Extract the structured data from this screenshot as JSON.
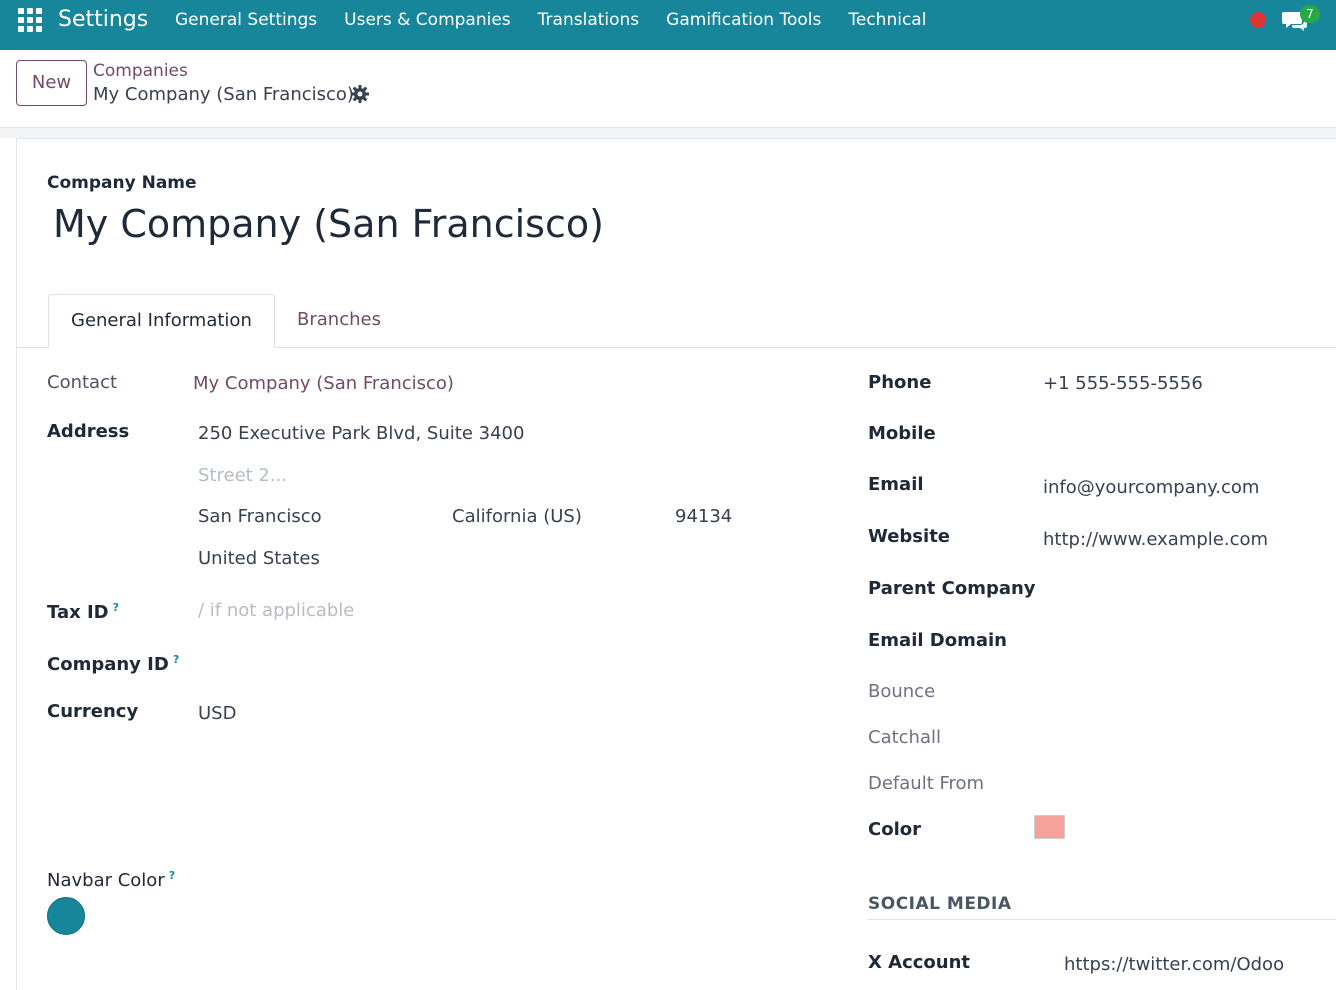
{
  "navbar": {
    "app_name": "Settings",
    "menu": [
      "General Settings",
      "Users & Companies",
      "Translations",
      "Gamification Tools",
      "Technical"
    ],
    "chat_count": "7",
    "color": "#17869a"
  },
  "control": {
    "new_label": "New",
    "breadcrumb_parent": "Companies",
    "breadcrumb_current": "My Company (San Francisco)"
  },
  "form": {
    "company_name_label": "Company Name",
    "company_name": "My Company (San Francisco)",
    "tabs": [
      "General Information",
      "Branches"
    ],
    "left": {
      "contact_label": "Contact",
      "contact_value": "My Company (San Francisco)",
      "address_label": "Address",
      "street": "250 Executive Park Blvd, Suite 3400",
      "street2_placeholder": "Street 2...",
      "city": "San Francisco",
      "state": "California (US)",
      "zip": "94134",
      "country": "United States",
      "tax_id_label": "Tax ID",
      "tax_id_placeholder": "/ if not applicable",
      "company_id_label": "Company ID",
      "currency_label": "Currency",
      "currency_value": "USD",
      "navbar_color_label": "Navbar Color",
      "help_mark": "?"
    },
    "right": {
      "phone_label": "Phone",
      "phone_value": "+1 555-555-5556",
      "mobile_label": "Mobile",
      "email_label": "Email",
      "email_value": "info@yourcompany.com",
      "website_label": "Website",
      "website_value": "http://www.example.com",
      "parent_company_label": "Parent Company",
      "email_domain_label": "Email Domain",
      "bounce_label": "Bounce",
      "catchall_label": "Catchall",
      "default_from_label": "Default From",
      "color_label": "Color",
      "color_value": "#f7a19d",
      "social_media_title": "SOCIAL MEDIA",
      "x_account_label": "X Account",
      "x_account_value": "https://twitter.com/Odoo"
    }
  }
}
